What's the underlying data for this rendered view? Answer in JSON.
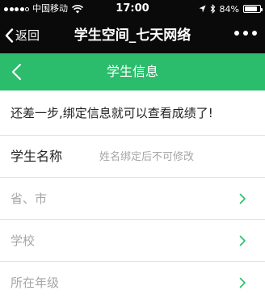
{
  "status_bar": {
    "carrier": "中国移动",
    "time": "17:00",
    "battery_text": "84%",
    "battery_level": 0.84,
    "signal_filled": 4,
    "signal_total": 5
  },
  "nav_bar": {
    "back_label": "返回",
    "title": "学生空间_七天网络",
    "more_icon": "more-dots-icon"
  },
  "header": {
    "title": "学生信息",
    "background": "#2bbd6c"
  },
  "notice": "还差一步,绑定信息就可以查看成绩了!",
  "form": {
    "student_name": {
      "label": "学生名称",
      "placeholder": "姓名绑定后不可修改",
      "value": ""
    },
    "rows": [
      {
        "label": "省、市",
        "icon": "chevron-right-icon"
      },
      {
        "label": "学校",
        "icon": "chevron-right-icon"
      },
      {
        "label": "所在年级",
        "icon": "chevron-right-icon"
      }
    ]
  },
  "colors": {
    "accent": "#2bbd6c",
    "chevron": "#2bbd6c",
    "system_bar": "#0a0a0a",
    "divider": "#e2e2e2"
  }
}
